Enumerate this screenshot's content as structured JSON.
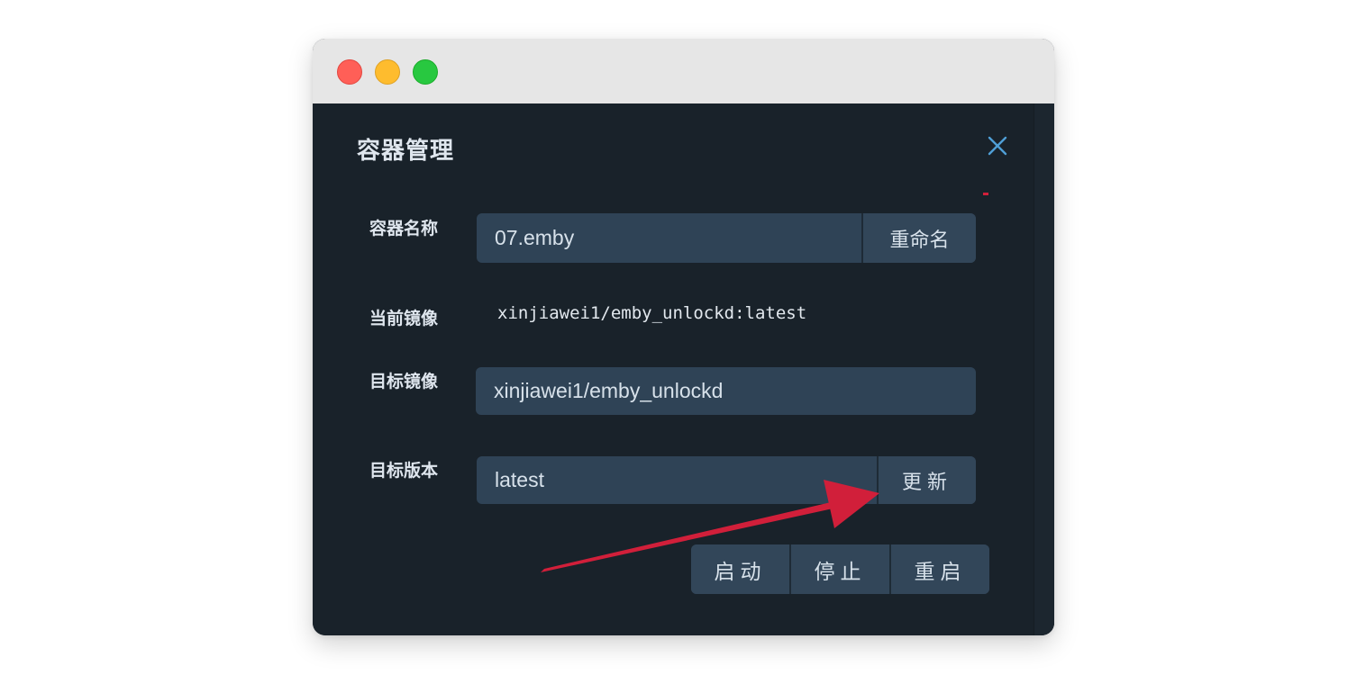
{
  "window": {
    "controls": {
      "close": "red-dot",
      "minimize": "yellow-dot",
      "maximize": "green-dot"
    }
  },
  "dialog": {
    "title": "容器管理",
    "close_icon": "close-icon",
    "fields": {
      "container_name": {
        "label": "容器名称",
        "value": "07.emby",
        "button_label": "重命名"
      },
      "current_image": {
        "label": "当前镜像",
        "value": "xinjiawei1/emby_unlockd:latest"
      },
      "target_image": {
        "label": "目标镜像",
        "value": "xinjiawei1/emby_unlockd"
      },
      "target_version": {
        "label": "目标版本",
        "value": "latest",
        "button_label": "更新"
      }
    },
    "actions": {
      "start": "启动",
      "stop": "停止",
      "restart": "重启"
    }
  },
  "annotation": {
    "arrow_color": "#d11f3a",
    "arrow_icon": "red-arrow-pointing-to-update"
  },
  "colors": {
    "dialog_bg": "#19222a",
    "field_bg": "#2f4356",
    "text": "#d7e1ea",
    "titlebar": "#e6e6e6"
  }
}
